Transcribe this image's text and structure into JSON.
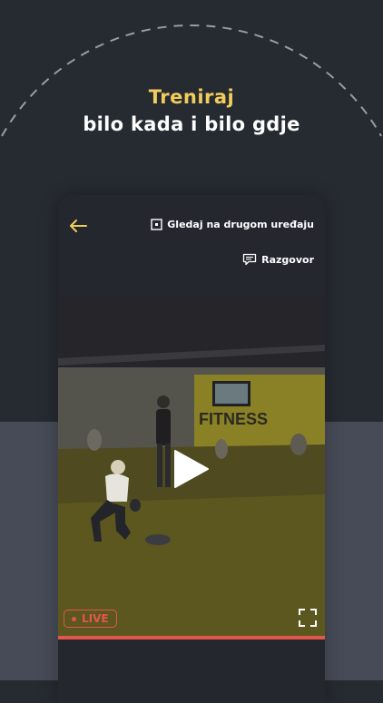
{
  "headline": {
    "accent": "Treniraj",
    "main": "bilo kada i bilo gdje"
  },
  "player": {
    "cast_label": "Gledaj na drugom uređaju",
    "chat_label": "Razgovor",
    "live_label": "LIVE",
    "video_sign": "FITNESS",
    "progress": 1.0
  },
  "icons": {
    "back": "arrow-left-icon",
    "cast": "cast-screen-icon",
    "chat": "chat-bubble-icon",
    "play": "play-icon",
    "fullscreen": "fullscreen-icon"
  },
  "colors": {
    "accent": "#f1cd5c",
    "live": "#e2574c",
    "background": "#262a31",
    "band": "#474b57"
  }
}
